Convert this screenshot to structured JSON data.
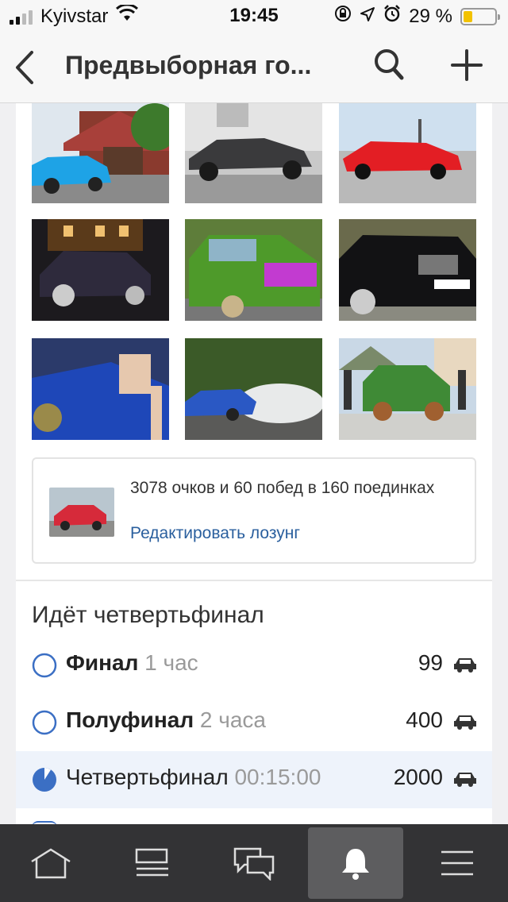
{
  "status_bar": {
    "carrier": "Kyivstar",
    "time": "19:45",
    "battery_text": "29 %",
    "battery_level": 0.29,
    "icons": [
      "signal-icon",
      "wifi-icon",
      "orientation-lock-icon",
      "location-icon",
      "alarm-icon",
      "battery-icon"
    ]
  },
  "header": {
    "title": "Предвыборная го...",
    "back_icon": "chevron-left-icon",
    "search_icon": "search-icon",
    "add_icon": "plus-icon"
  },
  "photos": [
    {
      "name": "blue-sports-car-photo"
    },
    {
      "name": "black-classic-car-photo"
    },
    {
      "name": "red-corvette-photo"
    },
    {
      "name": "night-stance-car-photo"
    },
    {
      "name": "green-lada-photo"
    },
    {
      "name": "black-mercedes-photo"
    },
    {
      "name": "blue-car-engine-photo"
    },
    {
      "name": "blue-drift-car-photo"
    },
    {
      "name": "green-niva-photo"
    }
  ],
  "slogan": {
    "text": "3078 очков и 60 побед в 160 поединках",
    "edit_link": "Редактировать лозунг"
  },
  "tournament": {
    "title": "Идёт четвертьфинал",
    "rounds": [
      {
        "name": "Финал",
        "time": "1 час",
        "count": "99",
        "state": "upcoming",
        "bold": true
      },
      {
        "name": "Полуфинал",
        "time": "2 часа",
        "count": "400",
        "state": "upcoming",
        "bold": true
      },
      {
        "name": "Четвертьфинал",
        "time": "00:15:00",
        "count": "2000",
        "state": "active",
        "bold": false
      }
    ]
  },
  "tab_bar": {
    "tabs": [
      {
        "name": "home-icon",
        "active": false
      },
      {
        "name": "feed-icon",
        "active": false
      },
      {
        "name": "messages-icon",
        "active": false
      },
      {
        "name": "bell-icon",
        "active": true
      },
      {
        "name": "menu-icon",
        "active": false
      }
    ]
  },
  "colors": {
    "accent": "#2a5f9e",
    "ring_blue": "#3b6fc4",
    "tab_bar_bg": "#333335",
    "battery_fill": "#f2c200"
  }
}
